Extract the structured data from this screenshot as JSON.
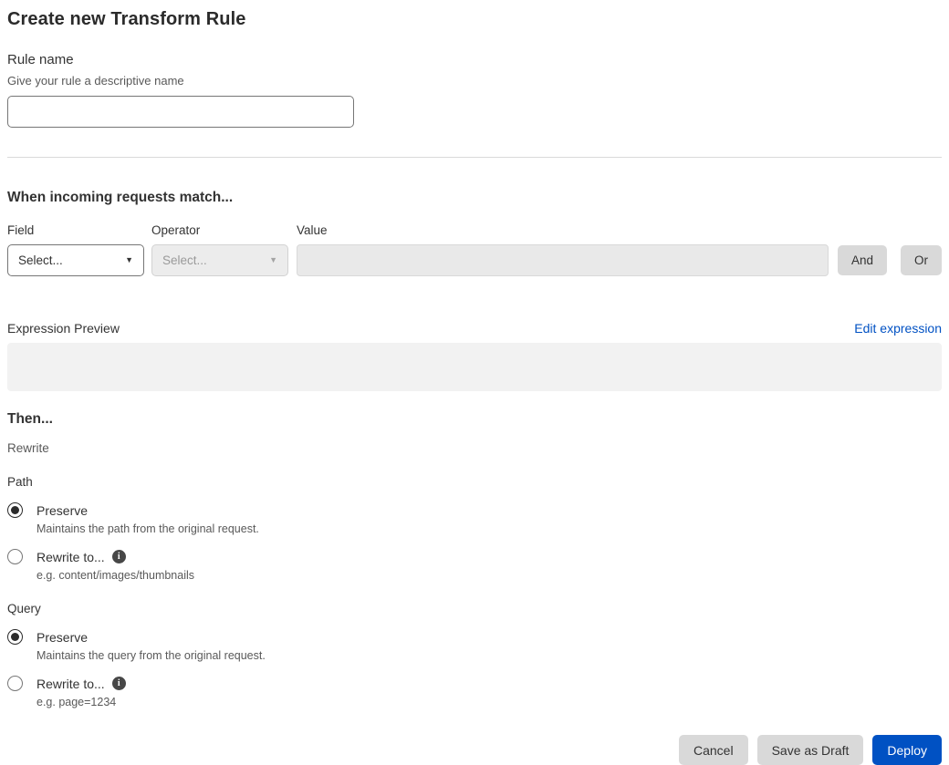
{
  "page": {
    "title": "Create new Transform Rule"
  },
  "rule_name": {
    "label": "Rule name",
    "helper": "Give your rule a descriptive name",
    "value": ""
  },
  "match": {
    "heading": "When incoming requests match...",
    "field": {
      "label": "Field",
      "selected_value": "Select...",
      "enabled": true
    },
    "operator": {
      "label": "Operator",
      "selected_value": "Select...",
      "enabled": false
    },
    "value": {
      "label": "Value",
      "value": "",
      "enabled": false
    },
    "and_label": "And",
    "or_label": "Or"
  },
  "expression": {
    "label": "Expression Preview",
    "edit_link": "Edit expression",
    "content": ""
  },
  "then": {
    "heading": "Then...",
    "subheading": "Rewrite",
    "path": {
      "label": "Path",
      "options": [
        {
          "label": "Preserve",
          "helper": "Maintains the path from the original request.",
          "selected": true
        },
        {
          "label": "Rewrite to...",
          "helper": "e.g. content/images/thumbnails",
          "selected": false,
          "has_info_icon": true
        }
      ]
    },
    "query": {
      "label": "Query",
      "options": [
        {
          "label": "Preserve",
          "helper": "Maintains the query from the original request.",
          "selected": true
        },
        {
          "label": "Rewrite to...",
          "helper": "e.g. page=1234",
          "selected": false,
          "has_info_icon": true
        }
      ]
    }
  },
  "footer": {
    "cancel_label": "Cancel",
    "save_draft_label": "Save as Draft",
    "deploy_label": "Deploy"
  },
  "colors": {
    "link_blue": "#0051c3",
    "deploy_blue": "#0051c3",
    "secondary_button_gray": "#d9d9d9",
    "disabled_field_gray": "#e9e9e9",
    "preview_box_gray": "#f2f2f2"
  }
}
